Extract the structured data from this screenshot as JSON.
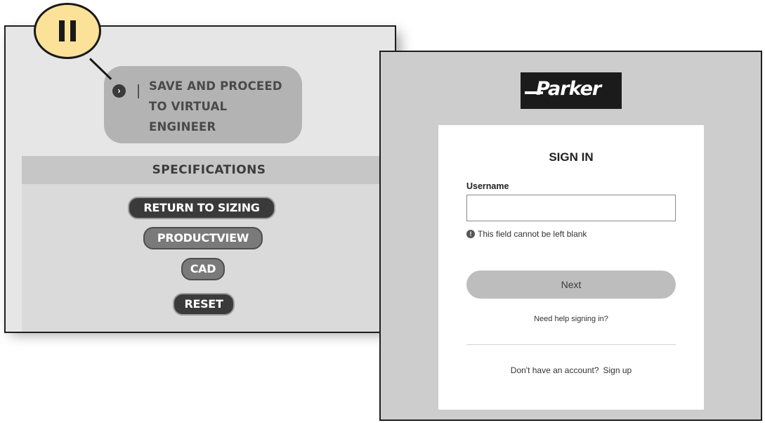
{
  "callout": {
    "number_icon": "roman-numeral-two-icon"
  },
  "left_panel": {
    "save_action": {
      "arrow_icon": "arrow-right-circle-icon",
      "lines": [
        "SAVE AND PROCEED",
        "TO VIRTUAL",
        "ENGINEER"
      ]
    },
    "specifications_title": "SPECIFICATIONS",
    "buttons": {
      "return_to_sizing": "RETURN TO SIZING",
      "productview": "PRODUCTVIEW",
      "cad": "CAD",
      "reset": "RESET"
    }
  },
  "right_panel": {
    "logo": {
      "text": "Parker",
      "icon": "parker-logo"
    },
    "sign_in": {
      "title": "SIGN IN",
      "username_label": "Username",
      "username_value": "",
      "error_icon": "exclamation-circle-icon",
      "error_message": "This field cannot be left blank",
      "next_label": "Next",
      "help_link": "Need help signing in?",
      "no_account_text": "Don't have an account?",
      "signup_link": "Sign up"
    }
  }
}
